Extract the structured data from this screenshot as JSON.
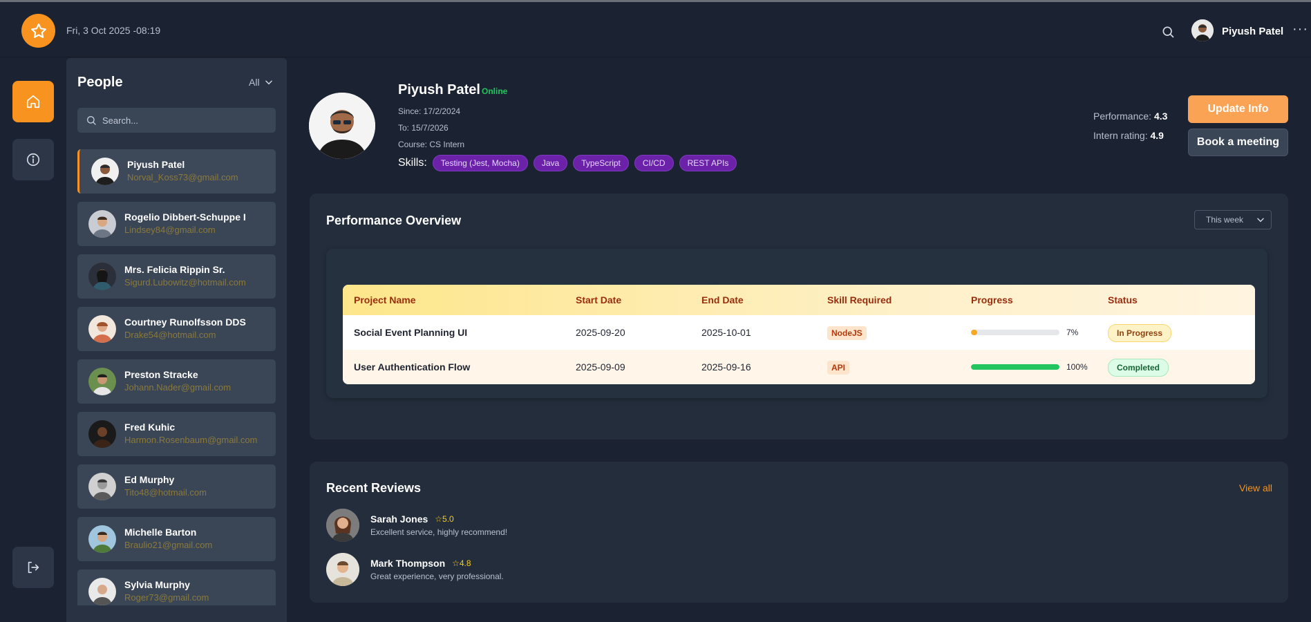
{
  "header": {
    "datetime": "Fri, 3 Oct 2025 -08:19",
    "user_name": "Piyush Patel",
    "more_label": "···"
  },
  "people_panel": {
    "title": "People",
    "filter_label": "All",
    "search_placeholder": "Search...",
    "people": [
      {
        "name": "Piyush Patel",
        "email": "Norval_Koss73@gmail.com"
      },
      {
        "name": "Rogelio Dibbert-Schuppe I",
        "email": "Lindsey84@gmail.com"
      },
      {
        "name": "Mrs. Felicia Rippin Sr.",
        "email": "Sigurd.Lubowitz@hotmail.com"
      },
      {
        "name": "Courtney Runolfsson DDS",
        "email": "Drake54@hotmail.com"
      },
      {
        "name": "Preston Stracke",
        "email": "Johann.Nader@gmail.com"
      },
      {
        "name": "Fred Kuhic",
        "email": "Harmon.Rosenbaum@gmail.com"
      },
      {
        "name": "Ed Murphy",
        "email": "Tito48@hotmail.com"
      },
      {
        "name": "Michelle Barton",
        "email": "Braulio21@gmail.com"
      },
      {
        "name": "Sylvia Murphy",
        "email": "Roger73@gmail.com"
      }
    ]
  },
  "profile": {
    "name": "Piyush Patel",
    "status": "Online",
    "since": "Since: 17/2/2024",
    "to": "To: 15/7/2026",
    "course": "Course: CS Intern",
    "skills_label": "Skills:",
    "skills": [
      "Testing (Jest, Mocha)",
      "Java",
      "TypeScript",
      "CI/CD",
      "REST APIs"
    ],
    "performance_label": "Performance:",
    "performance_value": "4.3",
    "rating_label": "Intern rating:",
    "rating_value": "4.9",
    "update_button": "Update Info",
    "meeting_button": "Book a meeting"
  },
  "performance": {
    "title": "Performance Overview",
    "period": "This week",
    "columns": [
      "Project Name",
      "Start Date",
      "End Date",
      "Skill Required",
      "Progress",
      "Status"
    ],
    "rows": [
      {
        "project": "Social Event Planning UI",
        "start": "2025-09-20",
        "end": "2025-10-01",
        "skill": "NodeJS",
        "progress": 7,
        "progress_label": "7%",
        "status": "In Progress"
      },
      {
        "project": "User Authentication Flow",
        "start": "2025-09-09",
        "end": "2025-09-16",
        "skill": "API",
        "progress": 100,
        "progress_label": "100%",
        "status": "Completed"
      }
    ]
  },
  "reviews": {
    "title": "Recent Reviews",
    "view_all": "View all",
    "items": [
      {
        "name": "Sarah Jones",
        "rating": "☆5.0",
        "text": "Excellent service, highly recommend!"
      },
      {
        "name": "Mark Thompson",
        "rating": "☆4.8",
        "text": "Great experience, very professional."
      }
    ]
  },
  "colors": {
    "accent": "#f7931e",
    "progress_low": "#f7a825",
    "progress_done": "#22c55e",
    "online": "#22c55e"
  },
  "icons": [
    "star-icon",
    "search-icon",
    "home-icon",
    "info-icon",
    "logout-icon",
    "chevron-down-icon"
  ]
}
